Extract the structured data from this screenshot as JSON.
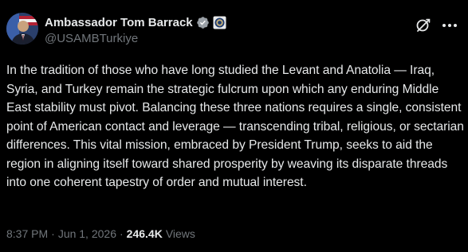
{
  "author": {
    "display_name": "Ambassador Tom Barrack",
    "handle": "@USAMBTurkiye",
    "verified_color": "#1d9bf0",
    "badges": [
      "verified-icon",
      "gov-affiliation-icon"
    ]
  },
  "actions": {
    "grok_icon": "grok-icon",
    "more_icon": "more-icon"
  },
  "post": {
    "text": "In the tradition of those who have long studied the Levant and Anatolia — Iraq, Syria, and Turkey remain the strategic fulcrum upon which any enduring Middle East stability must pivot. Balancing these three nations requires a single, consistent point of American contact and leverage — transcending tribal, religious, or sectarian differences. This vital mission, embraced by President Trump, seeks to aid the region in aligning itself toward shared prosperity by weaving its disparate threads into one coherent tapestry of order and mutual interest."
  },
  "meta": {
    "time": "8:37 PM",
    "separator": "·",
    "date": "Jun 1, 2026",
    "views_count": "246.4K",
    "views_label": "Views"
  },
  "colors": {
    "background": "#000000",
    "text_primary": "#e7e9ea",
    "text_secondary": "#71767b"
  }
}
